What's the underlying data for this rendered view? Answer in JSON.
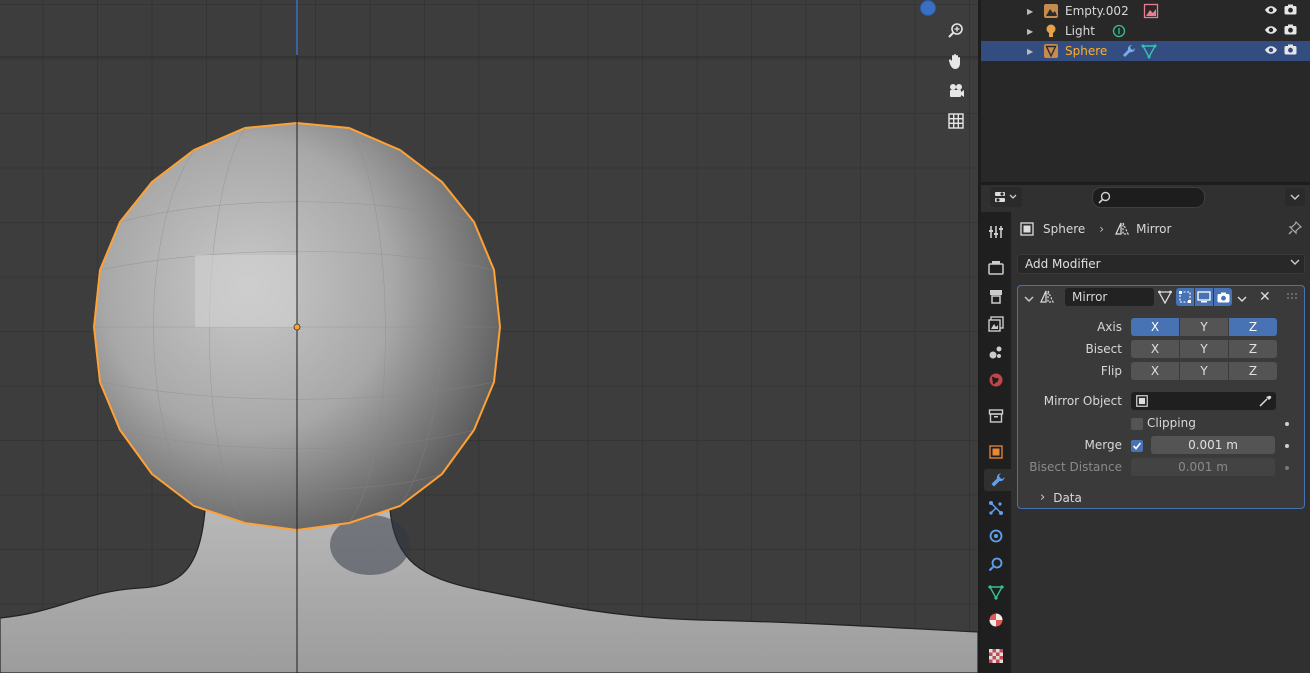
{
  "outliner": {
    "rows": [
      {
        "name": "Empty.002",
        "selected": false
      },
      {
        "name": "Light",
        "selected": false
      },
      {
        "name": "Sphere",
        "selected": true
      }
    ]
  },
  "properties": {
    "breadcrumb": {
      "object": "Sphere",
      "modifier": "Mirror"
    },
    "add_modifier_label": "Add Modifier",
    "modifier": {
      "name": "Mirror",
      "axis_label": "Axis",
      "bisect_label": "Bisect",
      "flip_label": "Flip",
      "axes": [
        "X",
        "Y",
        "Z"
      ],
      "axis_enabled": [
        true,
        false,
        true
      ],
      "mirror_object_label": "Mirror Object",
      "clipping_label": "Clipping",
      "clipping_checked": false,
      "merge_label": "Merge",
      "merge_checked": true,
      "merge_value": "0.001 m",
      "bisect_distance_label": "Bisect Distance",
      "bisect_distance_value": "0.001 m",
      "data_label": "Data"
    }
  },
  "colors": {
    "accent": "#4772b3",
    "selection_outline": "#ffa235",
    "selected_text": "#ffaf29"
  }
}
